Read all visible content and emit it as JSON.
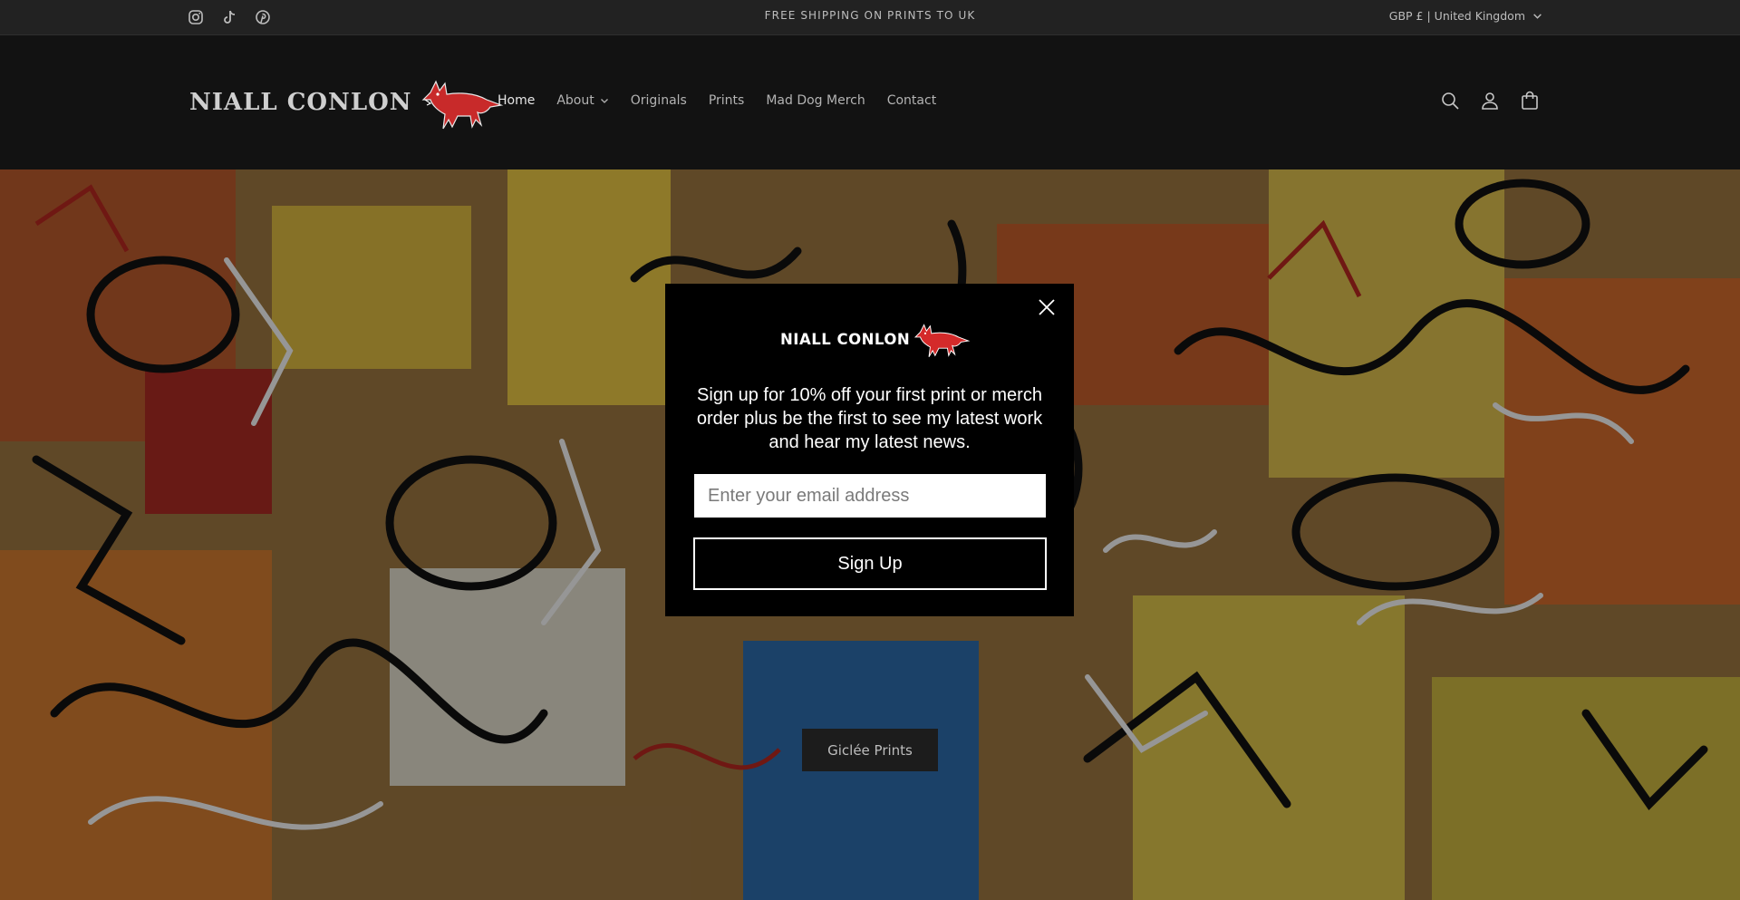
{
  "announcement": {
    "text": "FREE SHIPPING ON PRINTS TO UK",
    "locale": "GBP £ | United Kingdom",
    "social_icons": [
      "instagram-icon",
      "tiktok-icon",
      "pinterest-icon"
    ]
  },
  "header": {
    "logo_text": "NIALL CONLON",
    "nav": [
      {
        "label": "Home",
        "active": true
      },
      {
        "label": "About",
        "has_dropdown": true
      },
      {
        "label": "Originals"
      },
      {
        "label": "Prints"
      },
      {
        "label": "Mad Dog Merch"
      },
      {
        "label": "Contact"
      }
    ],
    "icons": [
      "search-icon",
      "account-icon",
      "cart-icon"
    ]
  },
  "hero": {
    "button_label": "Giclée Prints"
  },
  "popup": {
    "logo_text": "NIALL CONLON",
    "message": "Sign up for 10% off your first print or merch order plus be the first to see my latest work and hear my latest news.",
    "email_placeholder": "Enter your email address",
    "button_label": "Sign Up"
  },
  "colors": {
    "background": "#121212",
    "announcement_bg": "#222222",
    "popup_bg": "#000000",
    "logo_red": "#d42a2a"
  }
}
